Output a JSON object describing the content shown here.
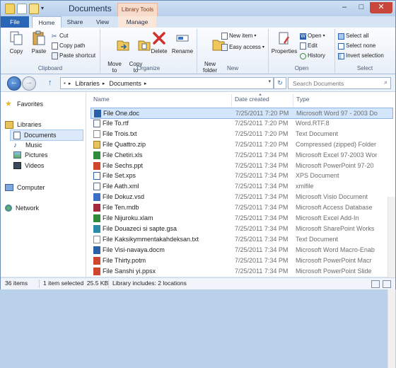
{
  "window": {
    "title": "Documents",
    "context_tab": "Library Tools"
  },
  "tabs": [
    "File",
    "Home",
    "Share",
    "View",
    "Manage"
  ],
  "ribbon": {
    "clipboard": {
      "label": "Clipboard",
      "copy": "Copy",
      "paste": "Paste",
      "cut": "Cut",
      "copy_path": "Copy path",
      "paste_shortcut": "Paste shortcut"
    },
    "organize": {
      "label": "Organize",
      "move_to": "Move\nto",
      "copy_to": "Copy\nto",
      "delete": "Delete",
      "rename": "Rename"
    },
    "new": {
      "label": "New",
      "new_folder": "New\nfolder",
      "new_item": "New item",
      "easy_access": "Easy access"
    },
    "open": {
      "label": "Open",
      "properties": "Properties",
      "open": "Open",
      "edit": "Edit",
      "history": "History"
    },
    "select": {
      "label": "Select",
      "select_all": "Select all",
      "select_none": "Select none",
      "invert_selection": "Invert selection"
    }
  },
  "address": {
    "crumbs": [
      "Libraries",
      "Documents"
    ],
    "search_placeholder": "Search Documents"
  },
  "nav": {
    "favorites": "Favorites",
    "libraries": "Libraries",
    "documents": "Documents",
    "music": "Music",
    "pictures": "Pictures",
    "videos": "Videos",
    "computer": "Computer",
    "network": "Network"
  },
  "columns": {
    "name": "Name",
    "date": "Date created",
    "type": "Type"
  },
  "files": [
    {
      "name": "File One.doc",
      "date": "7/25/2011 7:20 PM",
      "type": "Microsoft Word 97 - 2003 Do",
      "icon": "word-icon"
    },
    {
      "name": "File To.rtf",
      "date": "7/25/2011 7:20 PM",
      "type": "Word.RTF.8",
      "icon": "doc-icon"
    },
    {
      "name": "File Trois.txt",
      "date": "7/25/2011 7:20 PM",
      "type": "Text Document",
      "icon": "text-icon"
    },
    {
      "name": "File Quattro.zip",
      "date": "7/25/2011 7:20 PM",
      "type": "Compressed (zipped) Folder",
      "icon": "zip-icon"
    },
    {
      "name": "File Chetiri.xls",
      "date": "7/25/2011 7:34 PM",
      "type": "Microsoft Excel 97-2003 Wor",
      "icon": "excel-icon"
    },
    {
      "name": "File Sechs.ppt",
      "date": "7/25/2011 7:34 PM",
      "type": "Microsoft PowerPoint 97-20",
      "icon": "powerpoint-icon"
    },
    {
      "name": "File Set.xps",
      "date": "7/25/2011 7:34 PM",
      "type": "XPS Document",
      "icon": "xps-icon"
    },
    {
      "name": "File Aath.xml",
      "date": "7/25/2011 7:34 PM",
      "type": "xmlfile",
      "icon": "xml-icon"
    },
    {
      "name": "File Dokuz.vsd",
      "date": "7/25/2011 7:34 PM",
      "type": "Microsoft Visio Document",
      "icon": "visio-icon"
    },
    {
      "name": "File Ten.mdb",
      "date": "7/25/2011 7:34 PM",
      "type": "Microsoft Access Database",
      "icon": "access-icon"
    },
    {
      "name": "File Nijuroku.xlam",
      "date": "7/25/2011 7:34 PM",
      "type": "Microsoft Excel Add-In",
      "icon": "excel-icon"
    },
    {
      "name": "File Douazeci si sapte.gsa",
      "date": "7/25/2011 7:34 PM",
      "type": "Microsoft SharePoint Works",
      "icon": "sharepoint-icon"
    },
    {
      "name": "File Kaksikymmentakahdeksan.txt",
      "date": "7/25/2011 7:34 PM",
      "type": "Text Document",
      "icon": "text-icon"
    },
    {
      "name": "File Visi-navaya.docm",
      "date": "7/25/2011 7:34 PM",
      "type": "Microsoft Word Macro-Enab",
      "icon": "word-icon"
    },
    {
      "name": "File Thirty.potm",
      "date": "7/25/2011 7:34 PM",
      "type": "Microsoft PowerPoint Macr",
      "icon": "powerpoint-icon"
    },
    {
      "name": "File Sanshi yi.ppsx",
      "date": "7/25/2011 7:34 PM",
      "type": "Microsoft PowerPoint Slide",
      "icon": "powerpoint-icon"
    }
  ],
  "status": {
    "items": "36 items",
    "selected": "1 item selected  25.5 KB",
    "library": "Library includes: 2 locations"
  },
  "colors": {
    "accent": "#2a66b6",
    "selection": "#d4e6fb",
    "close": "#c9473a"
  }
}
